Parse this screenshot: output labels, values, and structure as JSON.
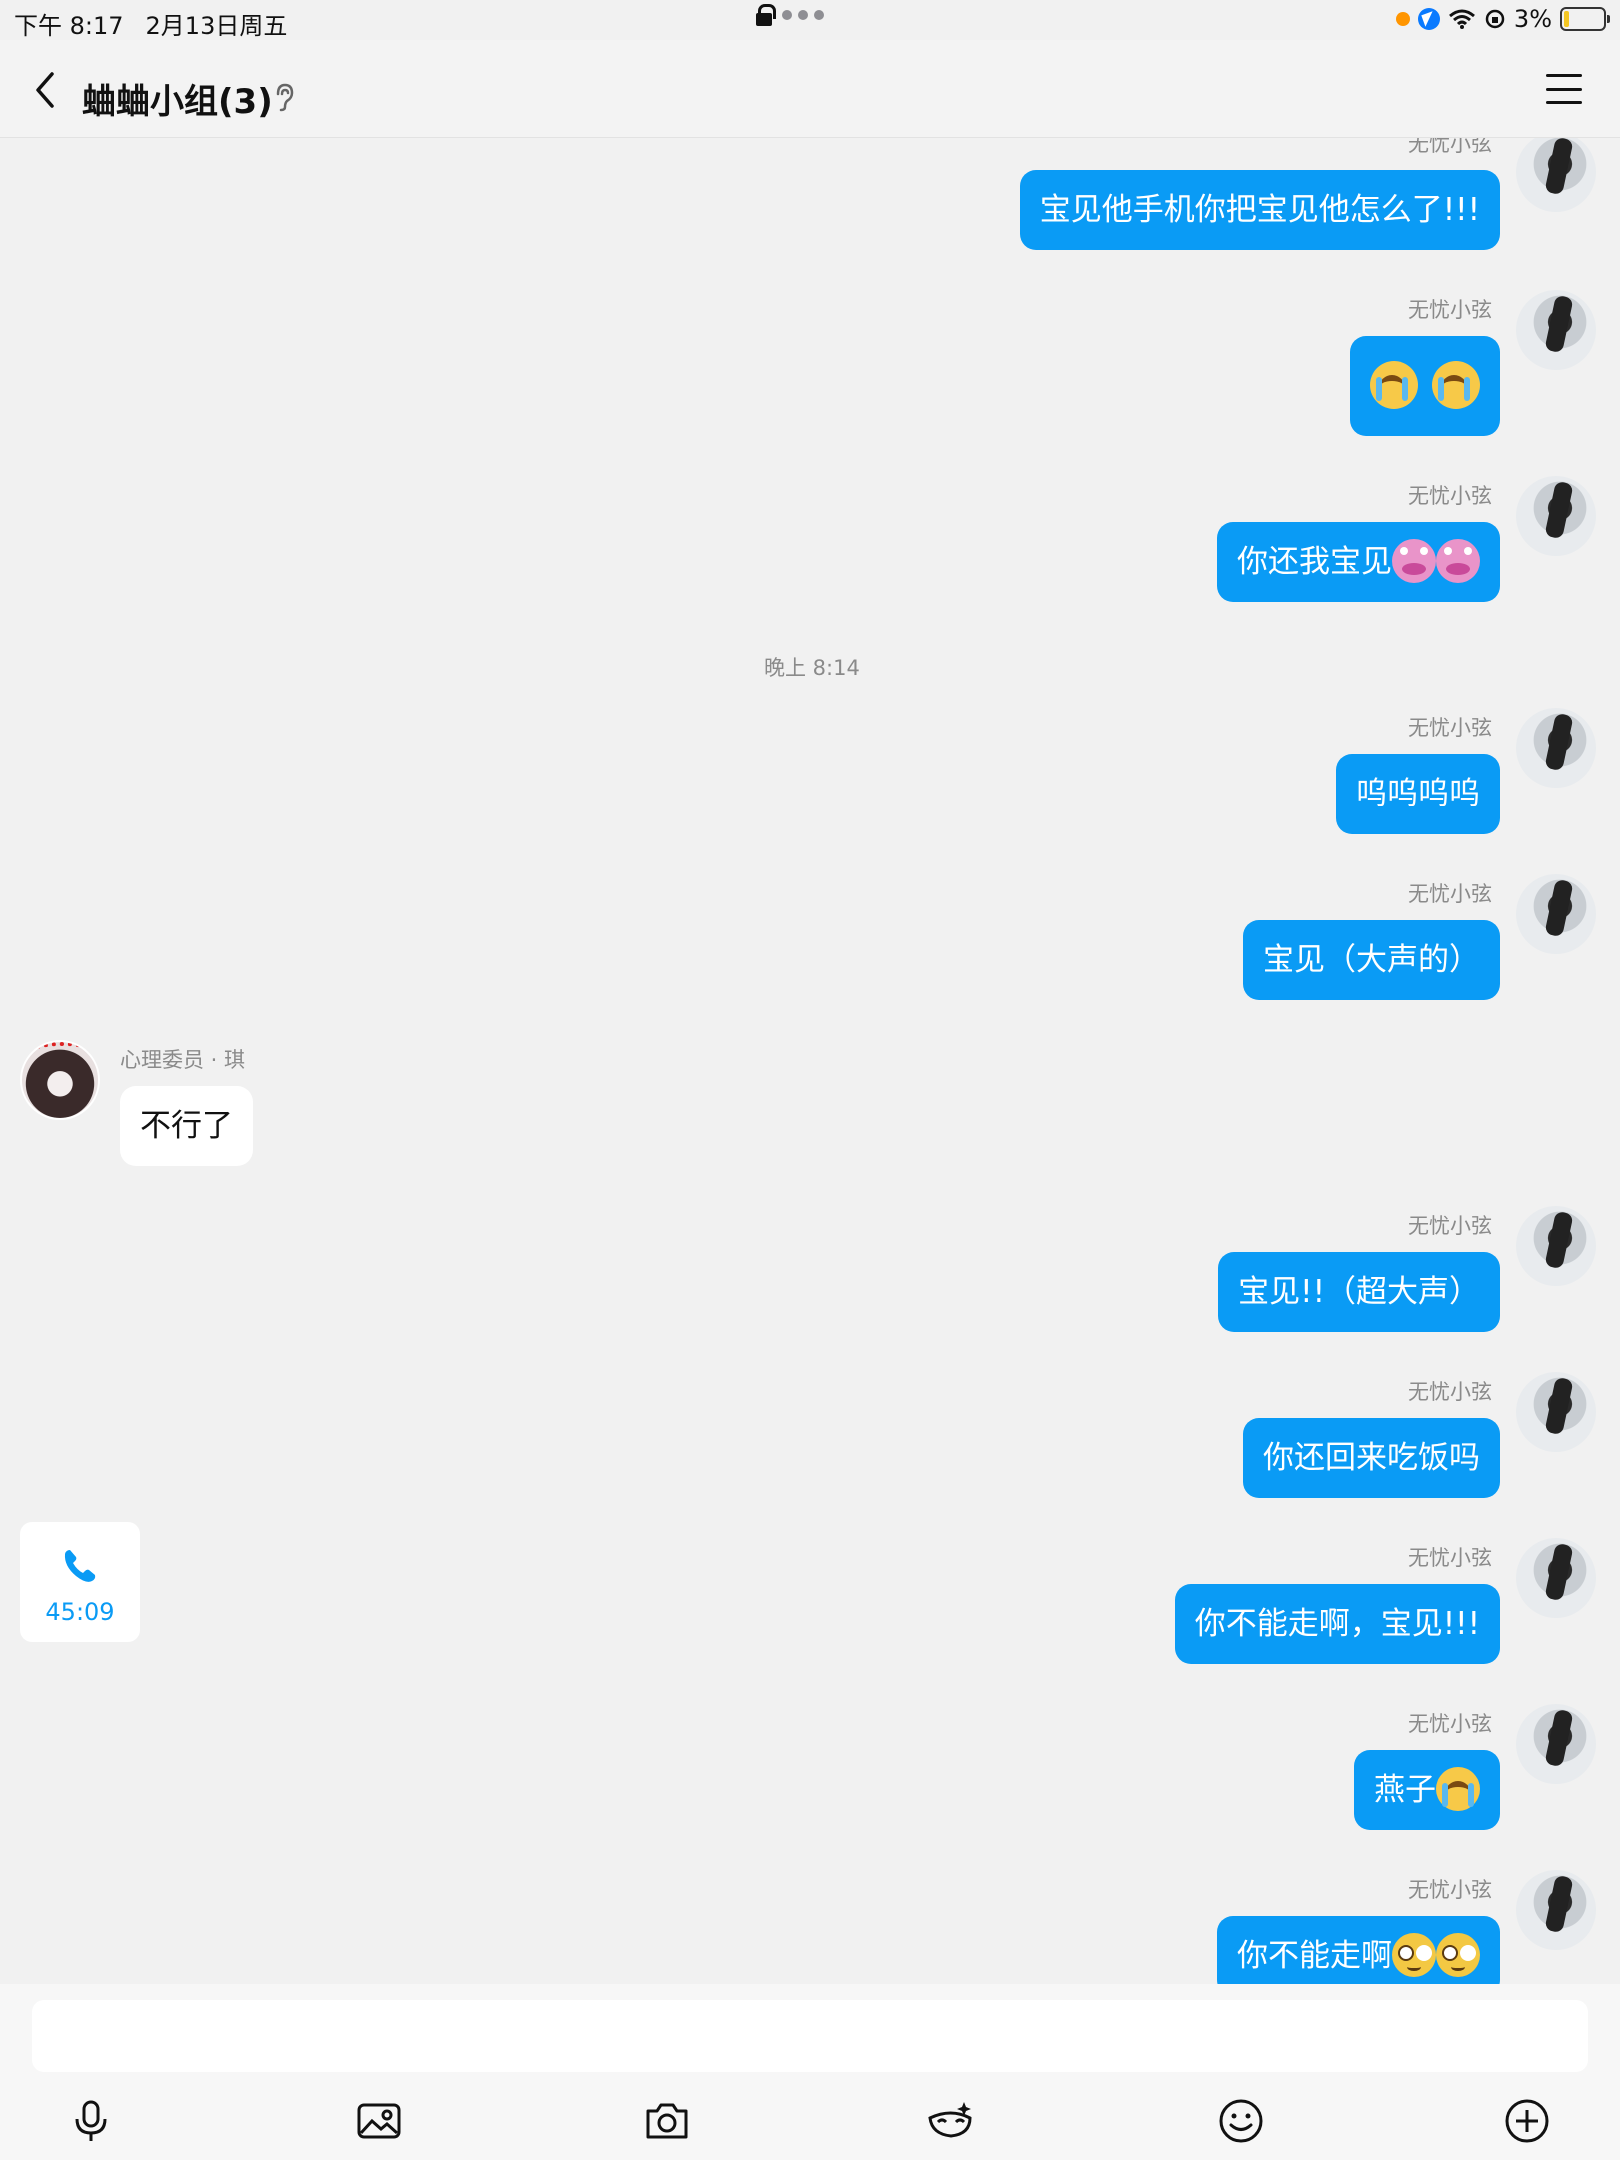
{
  "status": {
    "time": "下午 8:17",
    "date": "2月13日周五",
    "battery": "3%"
  },
  "header": {
    "title": "蛐蛐小组(3)"
  },
  "messages": [
    {
      "sender": "无忧小弦",
      "text": "宝见他手机你把宝见他怎么了!!!"
    },
    {
      "sender": "无忧小弦",
      "text": ""
    },
    {
      "sender": "无忧小弦",
      "text": "你还我宝见"
    },
    {
      "sender": "无忧小弦",
      "text": "呜呜呜呜"
    },
    {
      "sender": "无忧小弦",
      "text": "宝见（大声的）"
    },
    {
      "sender": "心理委员 · 琪",
      "text": "不行了"
    },
    {
      "sender": "无忧小弦",
      "text": "宝见!!（超大声）"
    },
    {
      "sender": "无忧小弦",
      "text": "你还回来吃饭吗"
    },
    {
      "sender": "无忧小弦",
      "text": "你不能走啊，宝见!!!"
    },
    {
      "sender": "无忧小弦",
      "text": "燕子"
    },
    {
      "sender": "无忧小弦",
      "text": "你不能走啊"
    }
  ],
  "timestamp": "晚上 8:14",
  "call": {
    "duration": "45:09"
  },
  "colors": {
    "bubble_mine": "#0a9bf5",
    "bubble_theirs": "#ffffff",
    "background": "#f1f1f1"
  },
  "toolbar": {
    "icons": [
      "microphone-icon",
      "image-icon",
      "camera-icon",
      "mask-icon",
      "emoji-icon",
      "plus-icon"
    ]
  }
}
